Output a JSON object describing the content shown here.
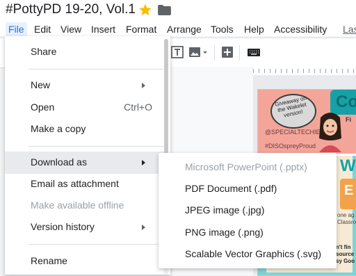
{
  "doc": {
    "title": "#PottyPD 19-20, Vol.1"
  },
  "menubar": [
    "File",
    "Edit",
    "View",
    "Insert",
    "Format",
    "Arrange",
    "Tools",
    "Help",
    "Accessibility",
    "Las"
  ],
  "file_menu": {
    "share": "Share",
    "new": "New",
    "open": "Open",
    "open_shortcut": "Ctrl+O",
    "make_copy": "Make a copy",
    "download_as": "Download as",
    "email_attachment": "Email as attachment",
    "make_offline": "Make available offline",
    "version_history": "Version history",
    "rename": "Rename"
  },
  "download_submenu": [
    {
      "label": "Microsoft PowerPoint (.pptx)",
      "disabled": true
    },
    {
      "label": "PDF Document (.pdf)",
      "disabled": false
    },
    {
      "label": "JPEG image (.jpg)",
      "disabled": false
    },
    {
      "label": "PNG image (.png)",
      "disabled": false
    },
    {
      "label": "Scalable Vector Graphics (.svg)",
      "disabled": false
    }
  ],
  "slide": {
    "bubble_text": "Giveaway on the Wakelet version!",
    "handle": "@SPECIALTECHIE",
    "hashtag": "#DISOspreyProud",
    "side_texts": [
      "Co",
      "Fi",
      "W",
      "E",
      "one ag",
      "Classro",
      "n't fin",
      "source",
      "sy Goo"
    ]
  },
  "colors": {
    "accent": "#1a73e8",
    "star": "#fbbc04",
    "slide_pink": "#f4a59a",
    "slide_teal": "#17a1a6"
  }
}
